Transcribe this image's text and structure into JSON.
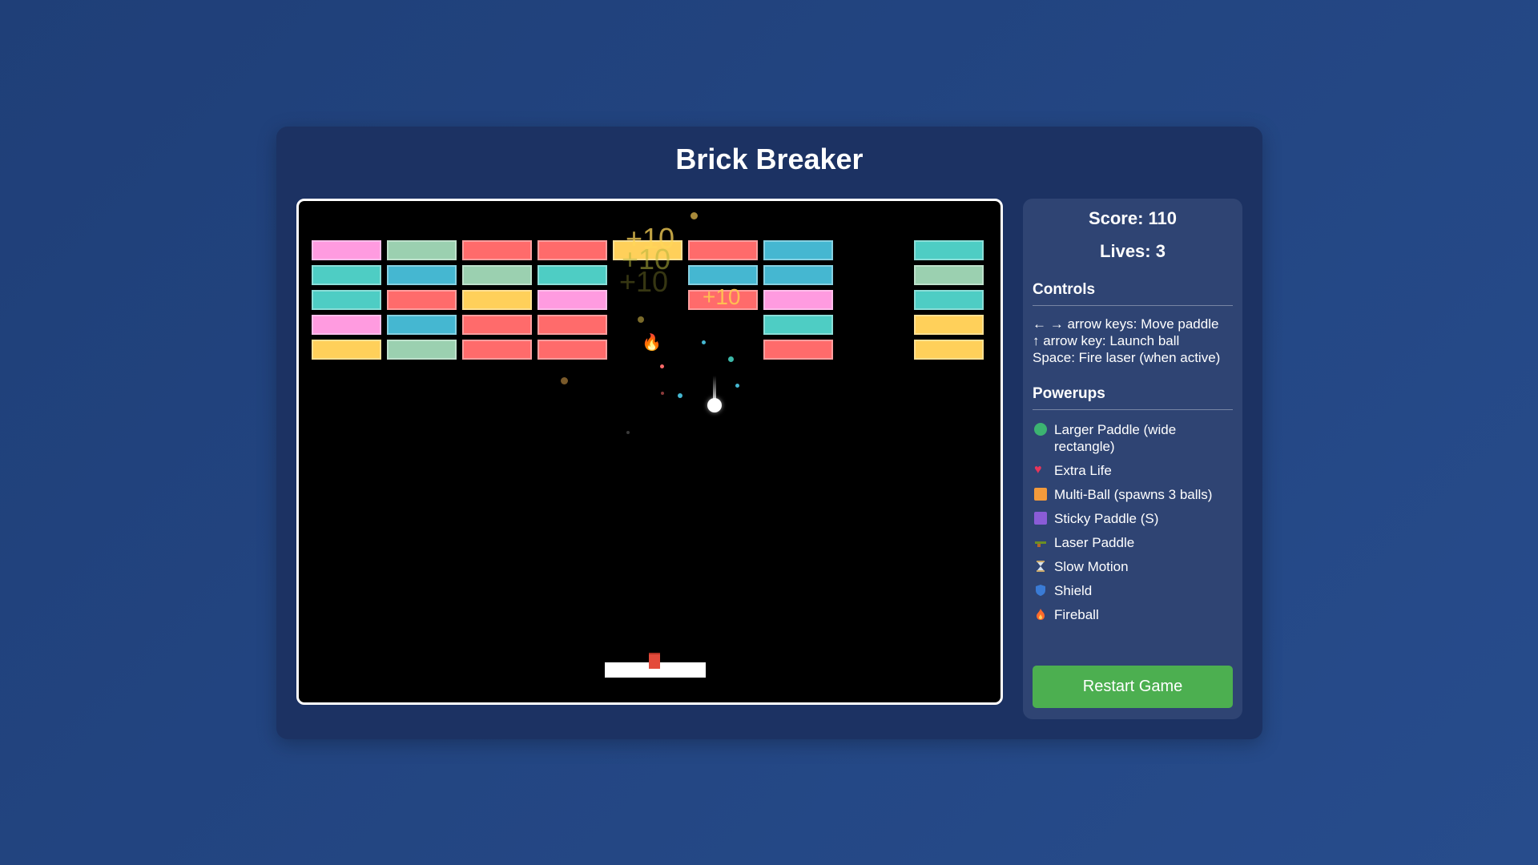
{
  "title": "Brick Breaker",
  "score_text": "Score: 110",
  "lives_text": "Lives: 3",
  "controls": {
    "heading": "Controls",
    "lines": [
      "← → arrow keys: Move paddle",
      "↑ arrow key: Launch ball",
      "Space: Fire laser (when active)"
    ]
  },
  "powerups": {
    "heading": "Powerups",
    "items": [
      {
        "label": "Larger Paddle (wide rectangle)",
        "icon": "green-circle-icon",
        "color": "#3cb371"
      },
      {
        "label": "Extra Life",
        "icon": "heart-icon",
        "color": "#e8345a"
      },
      {
        "label": "Multi-Ball (spawns 3 balls)",
        "icon": "orange-square-icon",
        "color": "#f39a3b"
      },
      {
        "label": "Sticky Paddle (S)",
        "icon": "purple-square-icon",
        "color": "#8a5cd6"
      },
      {
        "label": "Laser Paddle",
        "icon": "laser-gun-icon",
        "color": "#6b8e23"
      },
      {
        "label": "Slow Motion",
        "icon": "hourglass-icon",
        "color": "#c9a86a"
      },
      {
        "label": "Shield",
        "icon": "shield-icon",
        "color": "#3a7bd5"
      },
      {
        "label": "Fireball",
        "icon": "fire-icon",
        "color": "#ff6a2b"
      }
    ]
  },
  "restart_label": "Restart Game",
  "float_text": "+10",
  "colors": {
    "pink": "#ff9be0",
    "sage": "#9bd0b0",
    "red": "#ff6b6b",
    "teal": "#4ecdc4",
    "blue": "#45b7d1",
    "yellow": "#ffd05a"
  },
  "bricks": [
    [
      "pink",
      "sage",
      "red",
      "red",
      "yellow",
      "red",
      "blue",
      "",
      "teal"
    ],
    [
      "teal",
      "blue",
      "sage",
      "teal",
      "",
      "blue",
      "blue",
      "",
      "sage"
    ],
    [
      "teal",
      "red",
      "yellow",
      "pink",
      "",
      "red",
      "pink",
      "",
      "teal"
    ],
    [
      "pink",
      "blue",
      "red",
      "red",
      "",
      "",
      "teal",
      "",
      "yellow"
    ],
    [
      "yellow",
      "sage",
      "red",
      "red",
      "",
      "",
      "red",
      "",
      "yellow"
    ]
  ]
}
